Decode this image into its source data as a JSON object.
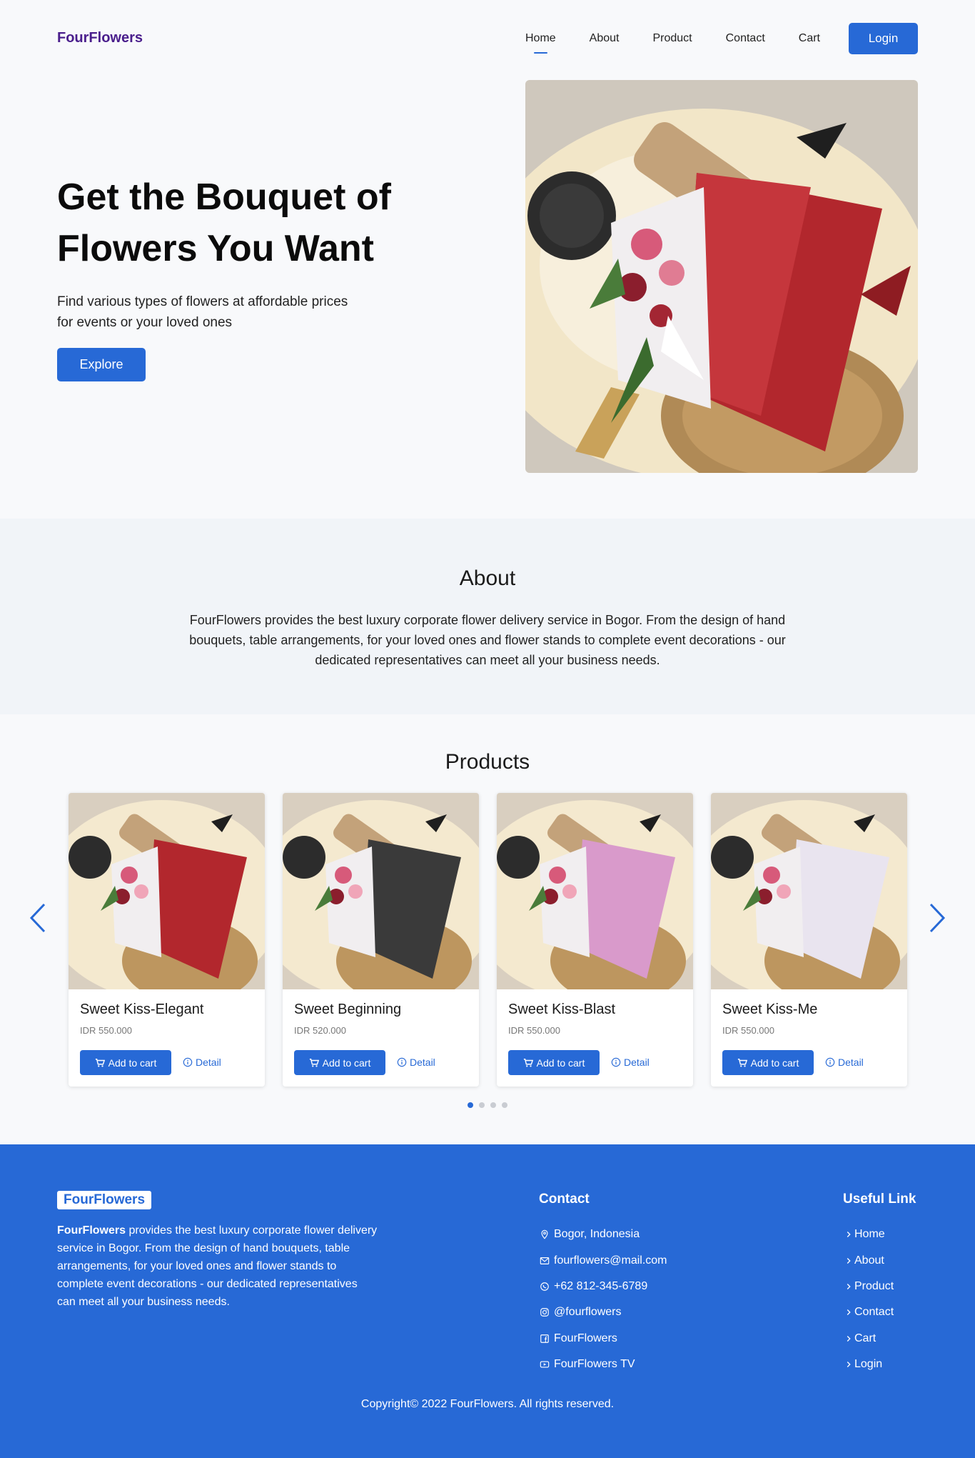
{
  "nav": {
    "brand": "FourFlowers",
    "items": [
      "Home",
      "About",
      "Product",
      "Contact",
      "Cart"
    ],
    "login": "Login"
  },
  "hero": {
    "title": "Get the Bouquet of Flowers You Want",
    "subtitle": "Find various types of flowers at affordable prices for events or your loved ones",
    "cta": "Explore"
  },
  "about": {
    "title": "About",
    "text": "FourFlowers provides the best luxury corporate flower delivery service in Bogor. From the design of hand bouquets, table arrangements, for your loved ones and flower stands to complete event decorations - our dedicated representatives can meet all your business needs."
  },
  "products": {
    "title": "Products",
    "cart_label": "Add to cart",
    "detail_label": "Detail",
    "items": [
      {
        "name": "Sweet Kiss-Elegant",
        "price": "IDR 550.000",
        "wrap": "#b2272d"
      },
      {
        "name": "Sweet Beginning",
        "price": "IDR 520.000",
        "wrap": "#3a3a3a"
      },
      {
        "name": "Sweet Kiss-Blast",
        "price": "IDR 550.000",
        "wrap": "#d99acb"
      },
      {
        "name": "Sweet Kiss-Me",
        "price": "IDR 550.000",
        "wrap": "#e9e4ef"
      }
    ]
  },
  "footer": {
    "brand": "FourFlowers",
    "brand_strong": "FourFlowers",
    "desc": " provides the best luxury corporate flower delivery service in Bogor. From the design of hand bouquets, table arrangements, for your loved ones and flower stands to complete event decorations - our dedicated representatives can meet all your business needs.",
    "contact_title": "Contact",
    "contacts": [
      {
        "icon": "location-icon",
        "text": "Bogor, Indonesia"
      },
      {
        "icon": "mail-icon",
        "text": "fourflowers@mail.com"
      },
      {
        "icon": "whatsapp-icon",
        "text": "+62 812-345-6789"
      },
      {
        "icon": "instagram-icon",
        "text": "@fourflowers"
      },
      {
        "icon": "facebook-icon",
        "text": "FourFlowers"
      },
      {
        "icon": "youtube-icon",
        "text": "FourFlowers TV"
      }
    ],
    "links_title": "Useful Link",
    "links": [
      "Home",
      "About",
      "Product",
      "Contact",
      "Cart",
      "Login"
    ],
    "copyright": "Copyright© 2022 FourFlowers. All rights reserved."
  },
  "colors": {
    "primary": "#2769d6",
    "brand": "#4a1e8c"
  }
}
